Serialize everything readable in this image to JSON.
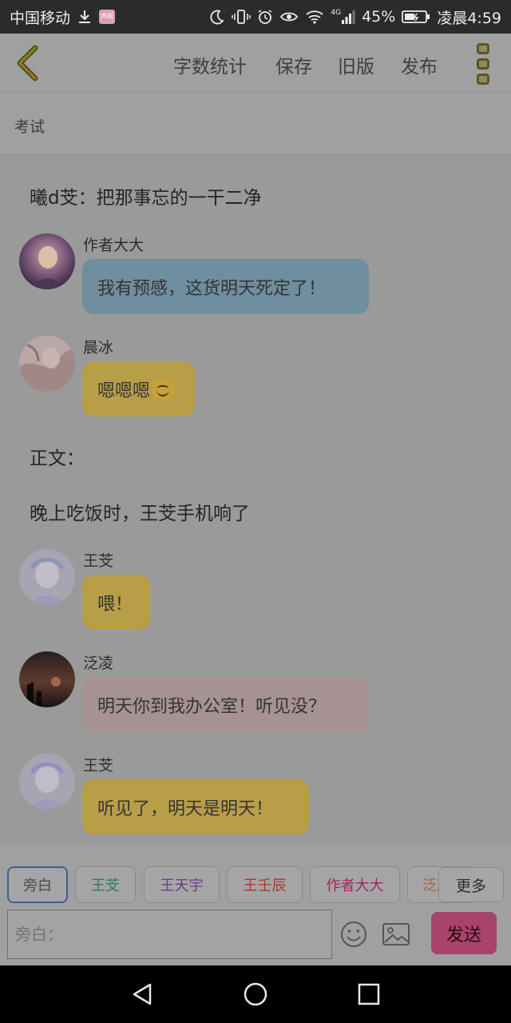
{
  "status_bar": {
    "carrier": "中国移动",
    "network": "4G",
    "battery": "45%",
    "time": "凌晨4:59",
    "app_badge": "声闻",
    "icons": [
      "download-icon",
      "app-badge-icon",
      "moon-icon",
      "vibrate-icon",
      "alarm-icon",
      "eye-icon",
      "wifi-icon",
      "signal-icon",
      "battery-icon"
    ]
  },
  "toolbar": {
    "back_icon": "chevron-left-icon",
    "word_count": "字数统计",
    "save": "保存",
    "old_version": "旧版",
    "publish": "发布",
    "more_icon": "vertical-more-icon"
  },
  "chapter": {
    "title": "考试"
  },
  "story": [
    {
      "type": "narration",
      "text": "曦d芠：把那事忘的一干二净"
    },
    {
      "type": "message",
      "speaker": "作者大大",
      "text": "我有预感，这货明天死定了！",
      "bubble_color": "#6f8ea0"
    },
    {
      "type": "message",
      "speaker": "晨冰",
      "text": "嗯嗯嗯",
      "emoji": "smile-emoji-icon",
      "bubble_color": "#b99e48"
    },
    {
      "type": "narration",
      "text": "正文："
    },
    {
      "type": "narration",
      "text": "晚上吃饭时，王芠手机响了"
    },
    {
      "type": "message",
      "speaker": "王芠",
      "text": "喂！",
      "bubble_color": "#b99e48"
    },
    {
      "type": "message",
      "speaker": "泛凌",
      "text": "明天你到我办公室！听见没？",
      "bubble_color": "#a69292"
    },
    {
      "type": "message",
      "speaker": "王芠",
      "text": "听见了，明天是明天！",
      "bubble_color": "#b99e48"
    }
  ],
  "characters": [
    {
      "label": "旁白",
      "color": "#4a4a4a",
      "active": true
    },
    {
      "label": "王芠",
      "color": "#2d7a5a"
    },
    {
      "label": "王天宇",
      "color": "#6b3d8f"
    },
    {
      "label": "王壬辰",
      "color": "#a63a2f"
    },
    {
      "label": "作者大大",
      "color": "#a3245e"
    },
    {
      "label": "泛凌",
      "color": "#a4622f"
    }
  ],
  "more_button": "更多",
  "composer": {
    "placeholder": "旁白：",
    "emoji_icon": "emoji-icon",
    "image_icon": "image-icon",
    "send": "发送"
  },
  "navigation": {
    "icons": [
      "back-triangle-icon",
      "home-circle-icon",
      "recents-square-icon"
    ]
  },
  "colors": {
    "accent": "#a8436a",
    "bubble_blue": "#6f8ea0",
    "bubble_yellow": "#b99e48",
    "bubble_pink": "#a69292",
    "back_arrow": "#5b5114"
  }
}
